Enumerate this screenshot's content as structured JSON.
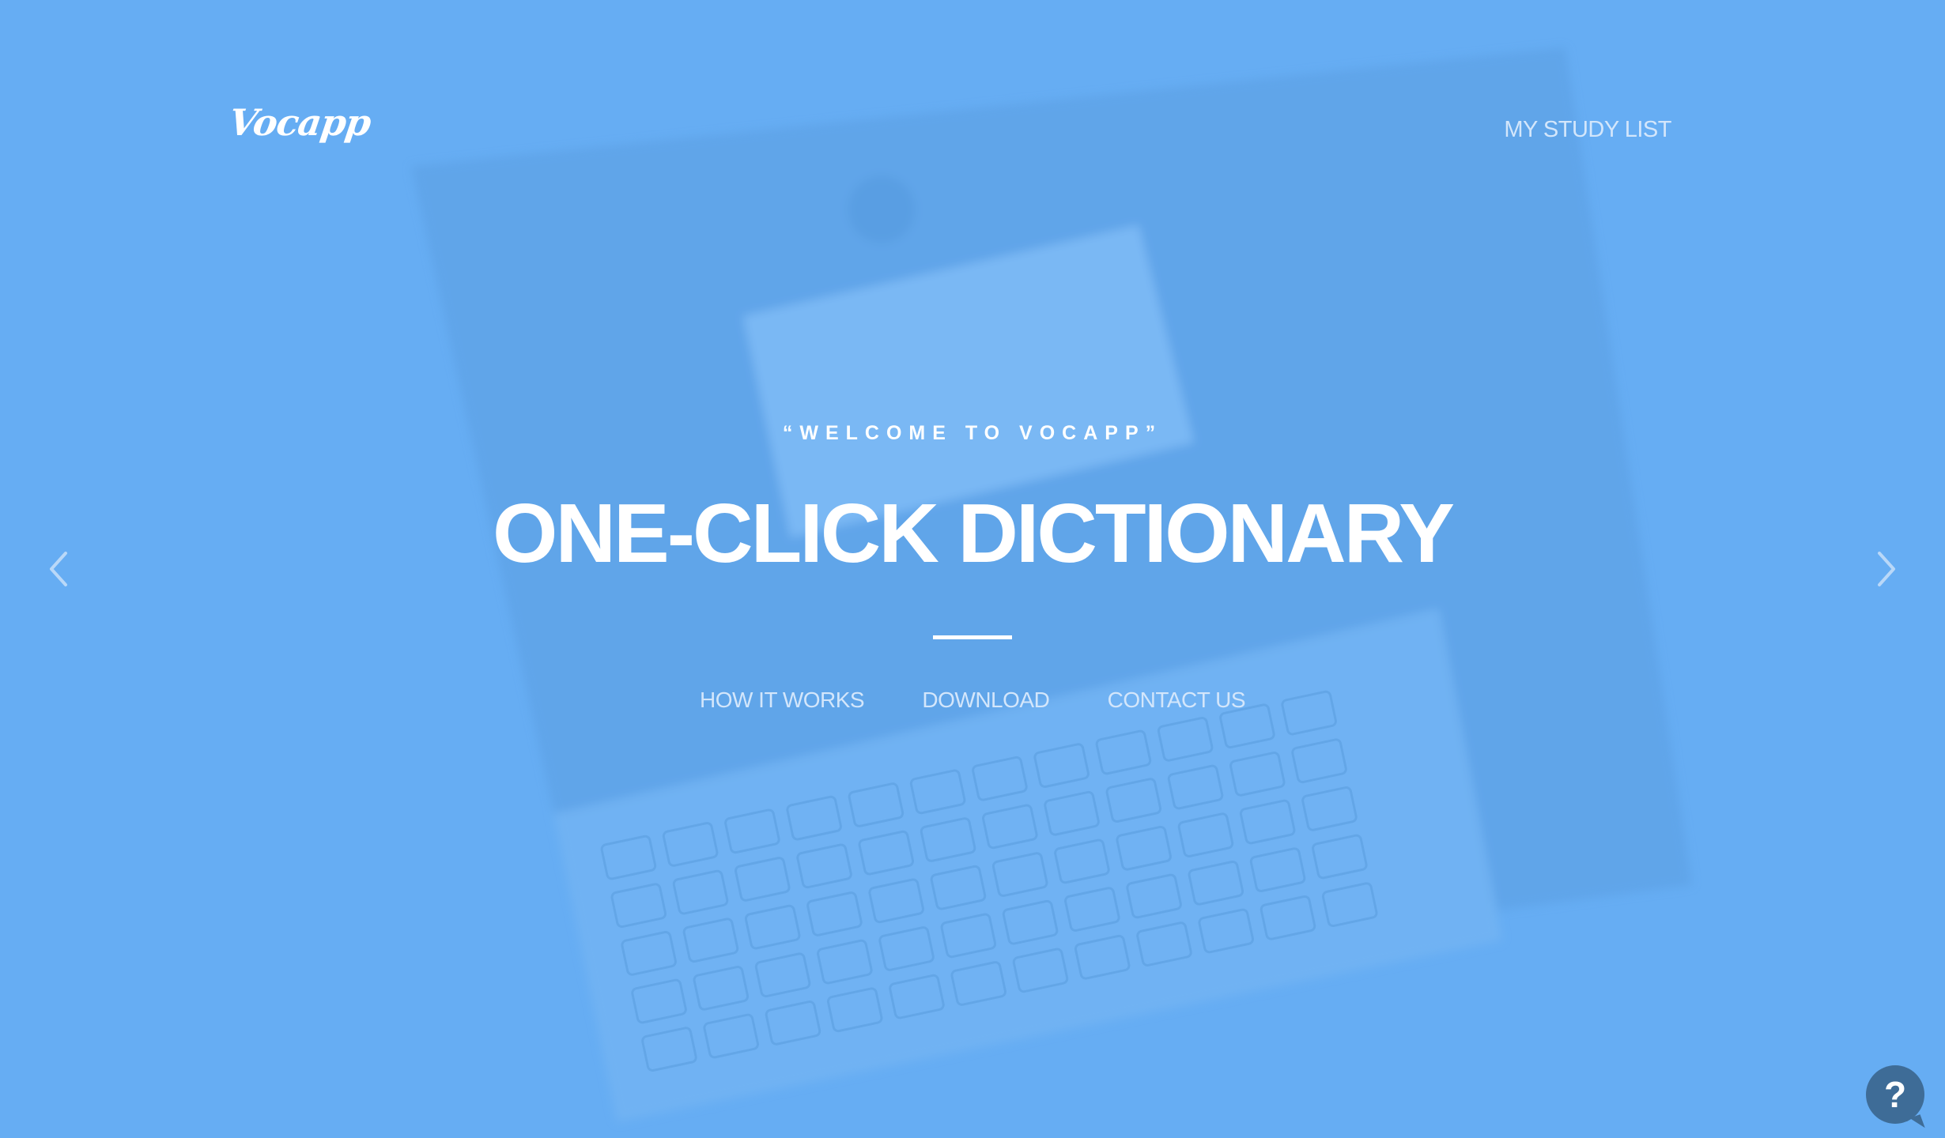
{
  "brand": {
    "logo_text": "Vocapp"
  },
  "header": {
    "study_list_label": "MY STUDY LIST"
  },
  "hero": {
    "eyebrow": "“WELCOME TO VOCAPP”",
    "title": "ONE-CLICK DICTIONARY"
  },
  "sub_nav": {
    "items": [
      {
        "label": "HOW IT WORKS"
      },
      {
        "label": "DOWNLOAD"
      },
      {
        "label": "CONTACT US"
      }
    ]
  },
  "carousel": {
    "prev_icon": "chevron-left-icon",
    "next_icon": "chevron-right-icon"
  },
  "help": {
    "icon": "question-icon",
    "glyph": "?"
  },
  "colors": {
    "background": "#66adf3",
    "help_button": "#3e6c97",
    "text_primary": "#ffffff",
    "text_link": "#d3e6fb"
  }
}
